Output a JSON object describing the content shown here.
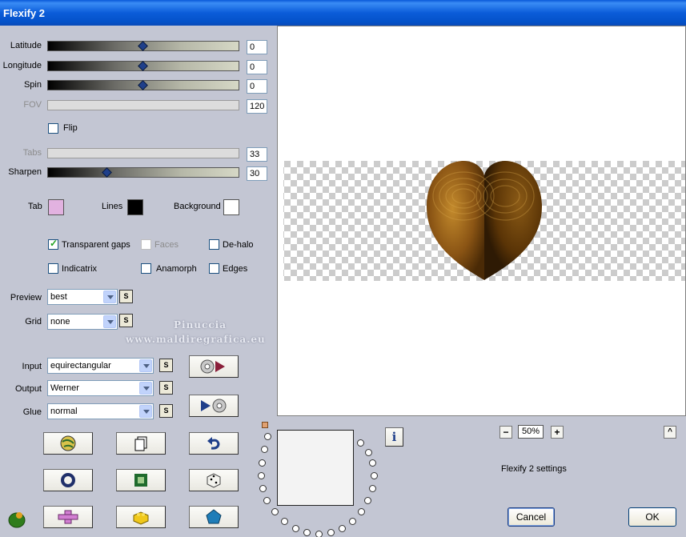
{
  "window": {
    "title": "Flexify 2"
  },
  "sliders": {
    "latitude": {
      "label": "Latitude",
      "value": "0",
      "position": 0.5
    },
    "longitude": {
      "label": "Longitude",
      "value": "0",
      "position": 0.5
    },
    "spin": {
      "label": "Spin",
      "value": "0",
      "position": 0.5
    },
    "fov": {
      "label": "FOV",
      "value": "120",
      "position": 1
    },
    "tabs": {
      "label": "Tabs",
      "value": "33",
      "position": 1
    },
    "sharpen": {
      "label": "Sharpen",
      "value": "30",
      "position": 0.3
    }
  },
  "flip": {
    "label": "Flip",
    "checked": false
  },
  "colors": {
    "tab": {
      "label": "Tab",
      "color": "#e2b2e0"
    },
    "lines": {
      "label": "Lines",
      "color": "#000000"
    },
    "background": {
      "label": "Background",
      "color": "#ffffff"
    }
  },
  "options": {
    "transparent_gaps": {
      "label": "Transparent gaps",
      "checked": true
    },
    "faces": {
      "label": "Faces",
      "checked": false
    },
    "dehalo": {
      "label": "De-halo",
      "checked": false
    },
    "indicatrix": {
      "label": "Indicatrix",
      "checked": false
    },
    "anamorph": {
      "label": "Anamorph",
      "checked": false
    },
    "edges": {
      "label": "Edges",
      "checked": false
    }
  },
  "selects": {
    "preview": {
      "label": "Preview",
      "value": "best"
    },
    "grid": {
      "label": "Grid",
      "value": "none"
    },
    "input": {
      "label": "Input",
      "value": "equirectangular"
    },
    "output": {
      "label": "Output",
      "value": "Werner"
    },
    "glue": {
      "label": "Glue",
      "value": "normal"
    }
  },
  "s_label": "S",
  "watermark": {
    "line1": "Pinuccia",
    "line2": "www.maldiregrafica.eu"
  },
  "zoom": {
    "value": "50%",
    "minus": "−",
    "plus": "+"
  },
  "settings_text": "Flexify 2 settings",
  "buttons": {
    "cancel": "Cancel",
    "ok": "OK",
    "info": "i",
    "collapse": "^"
  }
}
